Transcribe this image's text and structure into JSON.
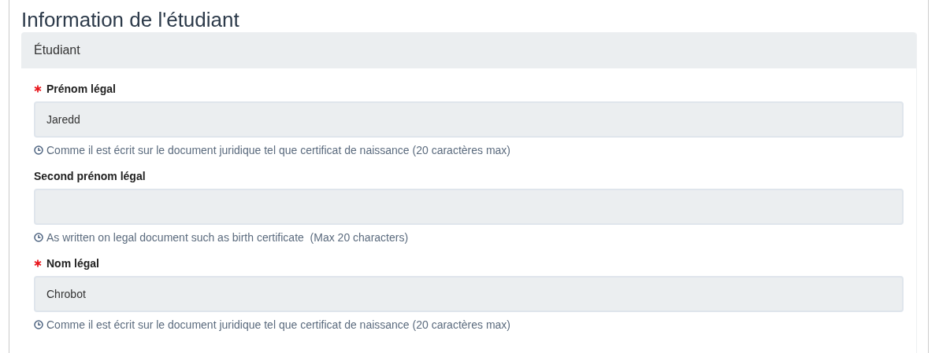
{
  "page": {
    "title": "Information de l'étudiant"
  },
  "panel": {
    "heading": "Étudiant",
    "fields": [
      {
        "label": "Prénom légal",
        "required": true,
        "value": "Jaredd",
        "help": "Comme il est écrit sur le document juridique tel que certificat de naissance (20 caractères max)"
      },
      {
        "label": "Second prénom légal",
        "required": false,
        "help": "As written on legal document such as birth certificate  (Max 20 characters)"
      },
      {
        "label": "Nom légal",
        "required": true,
        "value": "Chrobot",
        "help": "Comme il est écrit sur le document juridique tel que certificat de naissance (20 caractères max)"
      }
    ]
  }
}
